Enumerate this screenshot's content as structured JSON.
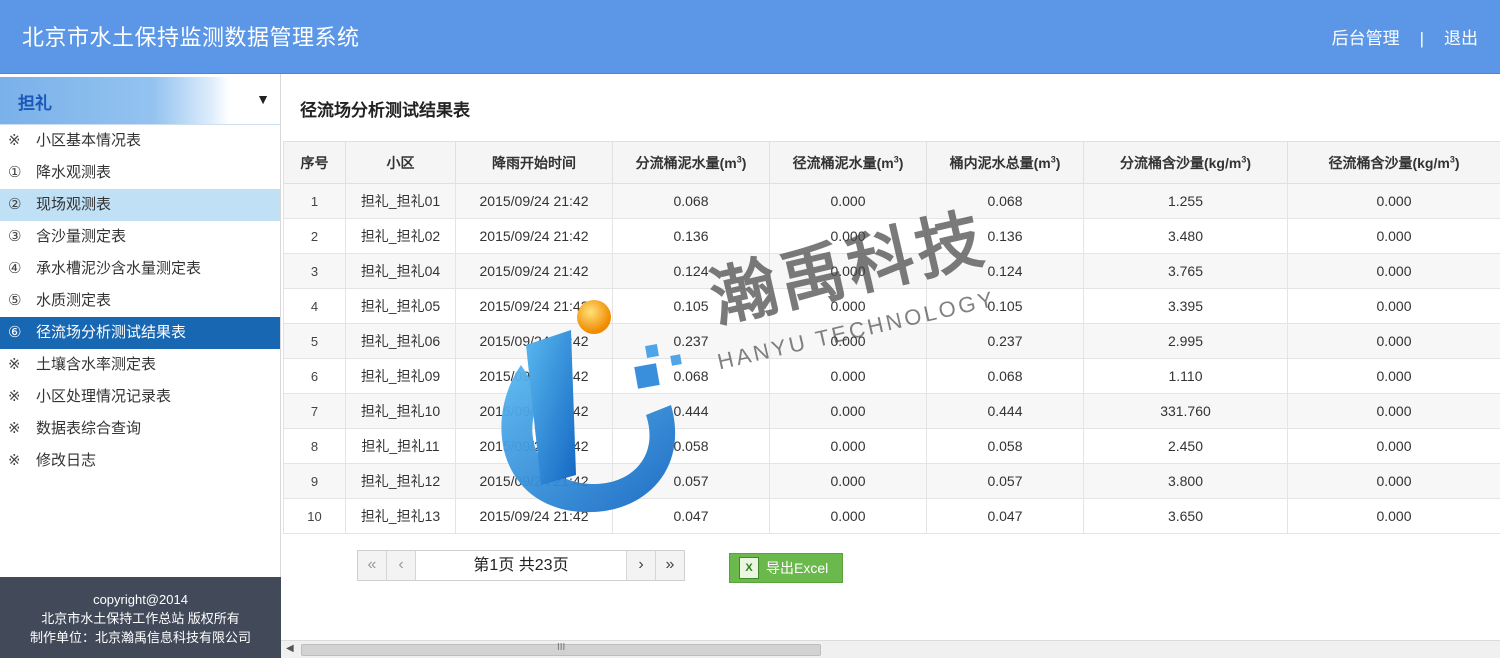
{
  "header": {
    "title": "北京市水土保持监测数据管理系统",
    "admin_link": "后台管理",
    "separator": "|",
    "logout_link": "退出"
  },
  "sidebar": {
    "station": "担礼",
    "caret": "▼",
    "items": [
      {
        "mark": "※",
        "label": "小区基本情况表"
      },
      {
        "mark": "①",
        "label": "降水观测表"
      },
      {
        "mark": "②",
        "label": "现场观测表"
      },
      {
        "mark": "③",
        "label": "含沙量测定表"
      },
      {
        "mark": "④",
        "label": "承水槽泥沙含水量测定表"
      },
      {
        "mark": "⑤",
        "label": "水质测定表"
      },
      {
        "mark": "⑥",
        "label": "径流场分析测试结果表"
      },
      {
        "mark": "※",
        "label": "土壤含水率测定表"
      },
      {
        "mark": "※",
        "label": "小区处理情况记录表"
      },
      {
        "mark": "※",
        "label": "数据表综合查询"
      },
      {
        "mark": "※",
        "label": "修改日志"
      }
    ],
    "footer": {
      "line1": "copyright@2014",
      "line2": "北京市水土保持工作总站 版权所有",
      "line3": "制作单位：北京瀚禹信息科技有限公司"
    }
  },
  "main": {
    "page_title": "径流场分析测试结果表",
    "columns": {
      "c0": "序号",
      "c1": "小区",
      "c2": "降雨开始时间",
      "c3": "分流桶泥水量(m",
      "c4": "径流桶泥水量(m",
      "c5": "桶内泥水总量(m",
      "c6": "分流桶含沙量(kg/m",
      "c7": "径流桶含沙量(kg/m",
      "sup": "3",
      "close": ")"
    },
    "rows": [
      [
        "1",
        "担礼_担礼01",
        "2015/09/24 21:42",
        "0.068",
        "0.000",
        "0.068",
        "1.255",
        "0.000"
      ],
      [
        "2",
        "担礼_担礼02",
        "2015/09/24 21:42",
        "0.136",
        "0.000",
        "0.136",
        "3.480",
        "0.000"
      ],
      [
        "3",
        "担礼_担礼04",
        "2015/09/24 21:42",
        "0.124",
        "0.000",
        "0.124",
        "3.765",
        "0.000"
      ],
      [
        "4",
        "担礼_担礼05",
        "2015/09/24 21:42",
        "0.105",
        "0.000",
        "0.105",
        "3.395",
        "0.000"
      ],
      [
        "5",
        "担礼_担礼06",
        "2015/09/24 21:42",
        "0.237",
        "0.000",
        "0.237",
        "2.995",
        "0.000"
      ],
      [
        "6",
        "担礼_担礼09",
        "2015/09/24 21:42",
        "0.068",
        "0.000",
        "0.068",
        "1.110",
        "0.000"
      ],
      [
        "7",
        "担礼_担礼10",
        "2015/09/24 21:42",
        "0.444",
        "0.000",
        "0.444",
        "331.760",
        "0.000"
      ],
      [
        "8",
        "担礼_担礼11",
        "2015/09/24 21:42",
        "0.058",
        "0.000",
        "0.058",
        "2.450",
        "0.000"
      ],
      [
        "9",
        "担礼_担礼12",
        "2015/09/24 21:42",
        "0.057",
        "0.000",
        "0.057",
        "3.800",
        "0.000"
      ],
      [
        "10",
        "担礼_担礼13",
        "2015/09/24 21:42",
        "0.047",
        "0.000",
        "0.047",
        "3.650",
        "0.000"
      ]
    ],
    "pager": {
      "first": "«",
      "prev": "‹",
      "info": "第1页  共23页",
      "next": "›",
      "last": "»"
    },
    "export_button": "导出Excel",
    "export_icon_text": "X"
  },
  "scrollbar": {
    "left_arrow": "◀",
    "grip": "III"
  },
  "watermark": {
    "text": "瀚禹科技",
    "sub": "HANYU TECHNOLOGY"
  },
  "colors": {
    "header_bg": "#5b97e6",
    "active_item_bg": "#1767b3",
    "hover_item_bg": "#bfe0f5",
    "footer_bg": "#424a5a",
    "export_bg": "#6bb84d"
  }
}
